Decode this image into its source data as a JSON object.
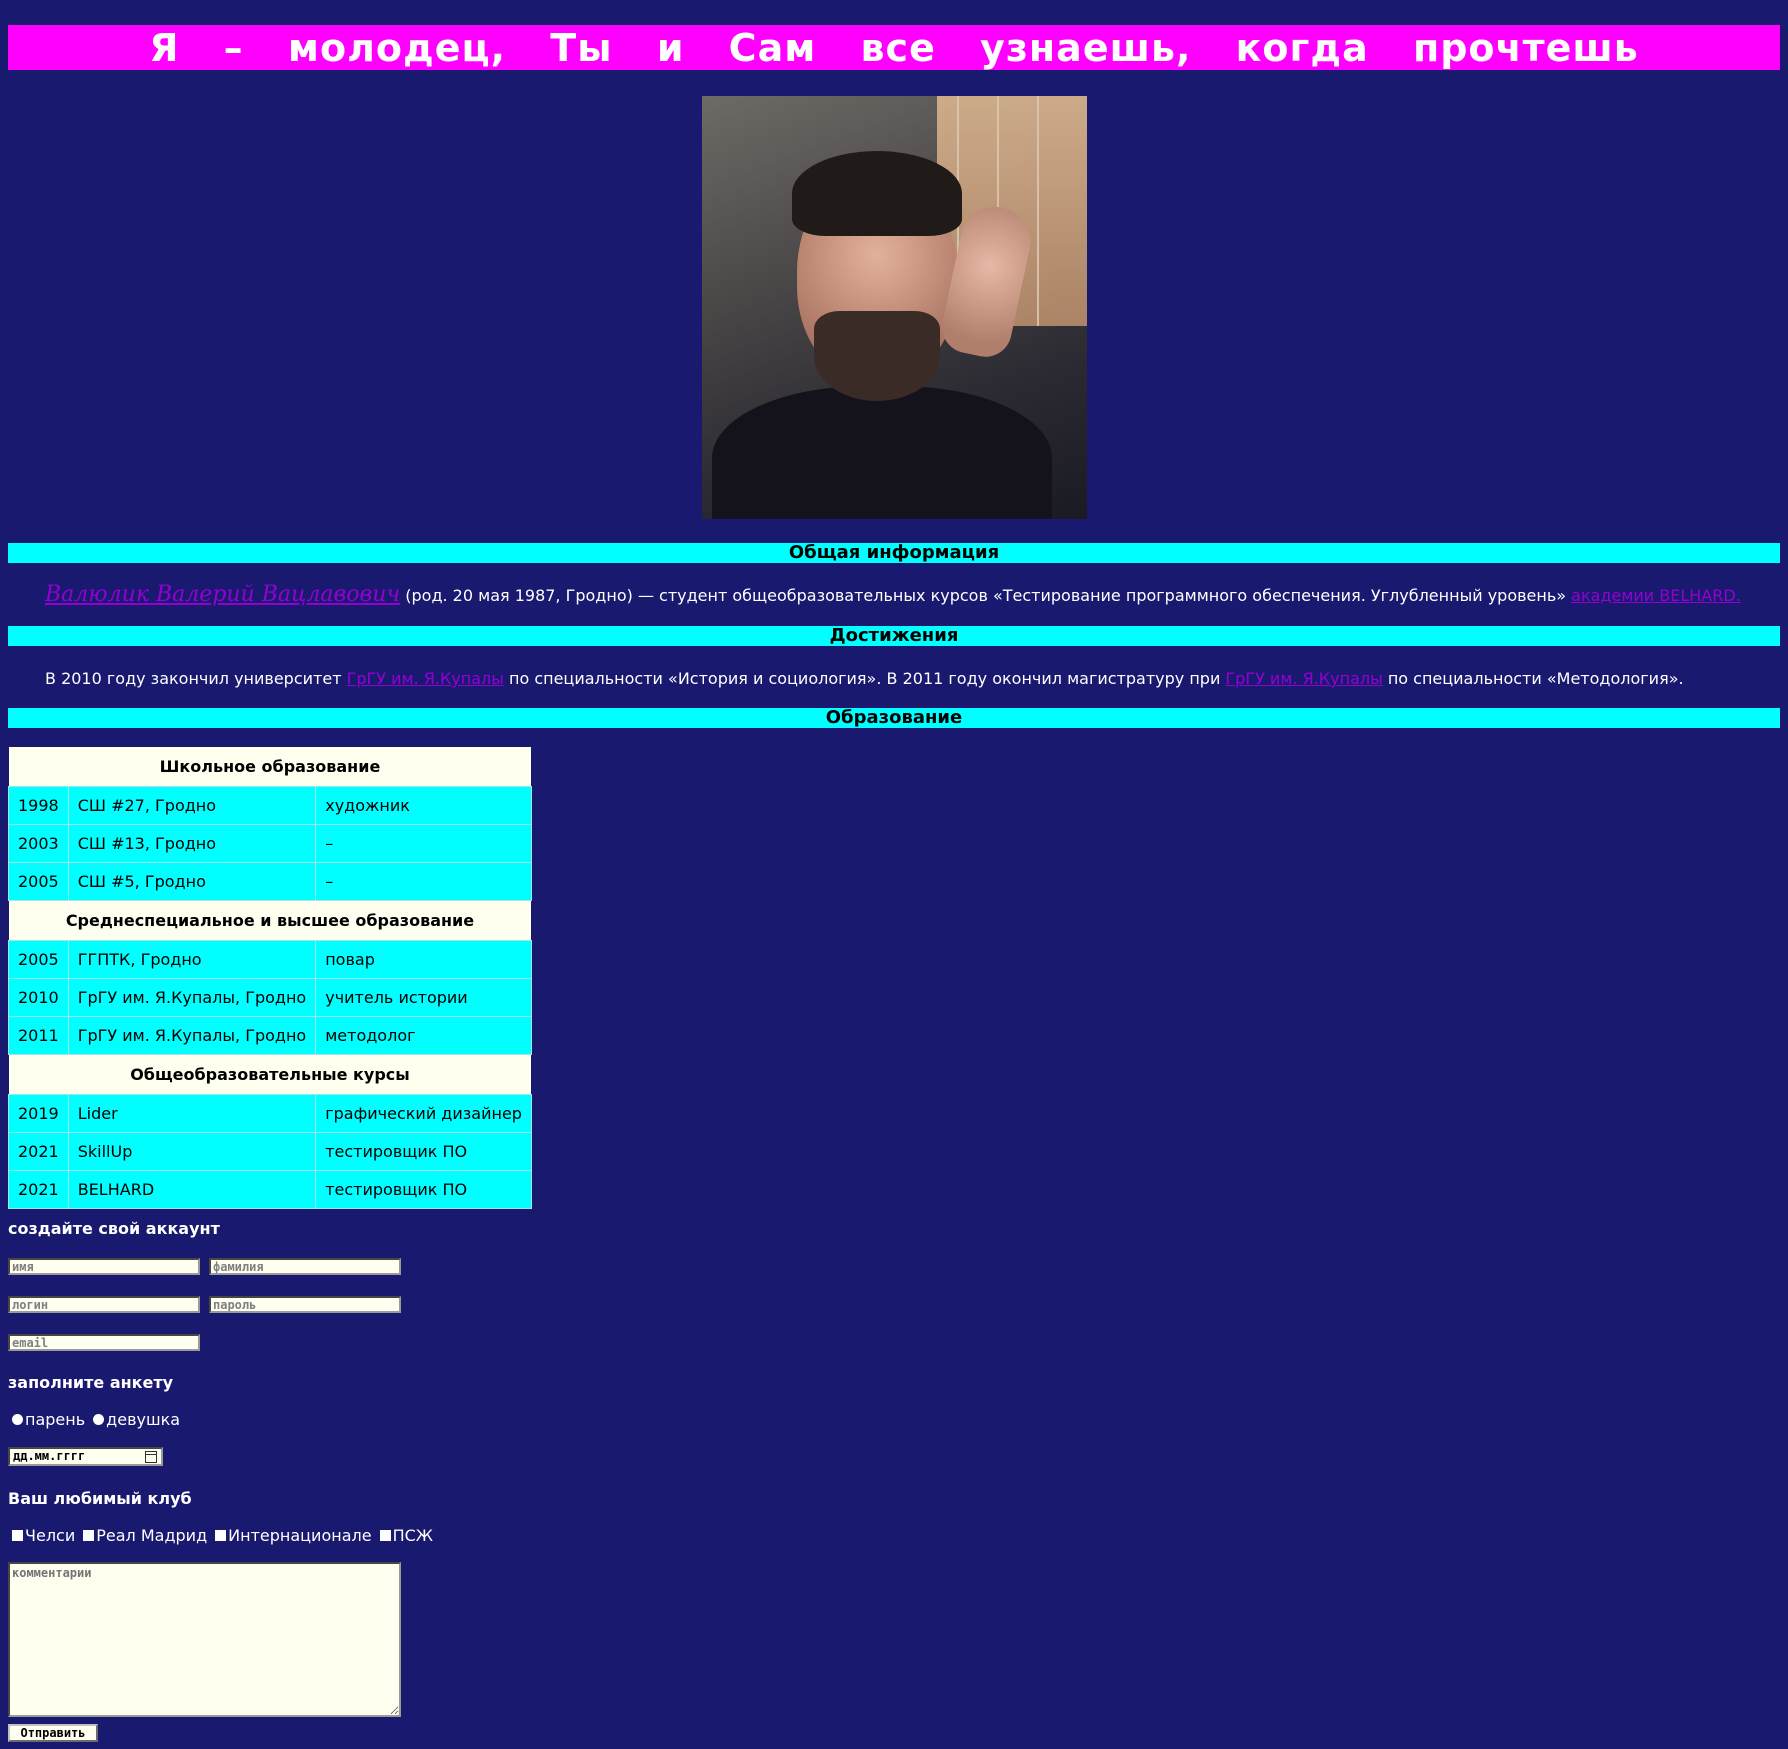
{
  "header": {
    "title": "Я – молодец, Ты и Сам все узнаешь, когда прочтешь"
  },
  "photo": {
    "alt_icon": "portrait-photo"
  },
  "sections": {
    "general": "Общая информация",
    "achievements": "Достижения",
    "education": "Образование"
  },
  "general_info": {
    "name_link": "Валюлик Валерий Вацлавович",
    "text": " (род. 20 мая 1987, Гродно) — студент общеобразовательных курсов «Тестирование программного обеспечения. Углубленный уровень» ",
    "academy_link": "академии BELHARD."
  },
  "achievements_info": {
    "part1": "В 2010 году закончил университет ",
    "link1": "ГрГУ им. Я.Купалы",
    "part2": " по специальности «История и социология». В 2011 году окончил магистратуру при ",
    "link2": "ГрГУ им. Я.Купалы",
    "part3": " по специальности «Методология»."
  },
  "education_table": {
    "school_header": "Школьное образование",
    "school_rows": [
      [
        "1998",
        "СШ #27, Гродно",
        "художник"
      ],
      [
        "2003",
        "СШ #13, Гродно",
        "–"
      ],
      [
        "2005",
        "СШ #5, Гродно",
        "–"
      ]
    ],
    "higher_header": "Среднеспециальное и высшее образование",
    "higher_rows": [
      [
        "2005",
        "ГГПТК, Гродно",
        "повар"
      ],
      [
        "2010",
        "ГрГУ им. Я.Купалы, Гродно",
        "учитель истории"
      ],
      [
        "2011",
        "ГрГУ им. Я.Купалы, Гродно",
        "методолог"
      ]
    ],
    "courses_header": "Общеобразовательные курсы",
    "courses_rows": [
      [
        "2019",
        "Lider",
        "графический дизайнер"
      ],
      [
        "2021",
        "SkillUp",
        "тестировщик ПО"
      ],
      [
        "2021",
        "BELHARD",
        "тестировщик ПО"
      ]
    ]
  },
  "form": {
    "account_heading": "создайте свой аккаунт",
    "first_name_placeholder": "имя",
    "last_name_placeholder": "фамилия",
    "login_placeholder": "логин",
    "password_placeholder": "пароль",
    "email_placeholder": "email",
    "survey_heading": "заполните анкету",
    "gender_male": "парень",
    "gender_female": "девушка",
    "date_placeholder": "дд.мм.гггг",
    "club_heading": "Ваш любимый клуб",
    "clubs": [
      "Челси",
      "Реал Мадрид",
      "Интернационале",
      "ПСЖ"
    ],
    "comment_placeholder": "комментарии",
    "submit_label": "Отправить"
  },
  "colors": {
    "background": "#191970",
    "banner": "#ff00ff",
    "section_bar": "#00ffff",
    "link": "#9400d3"
  }
}
